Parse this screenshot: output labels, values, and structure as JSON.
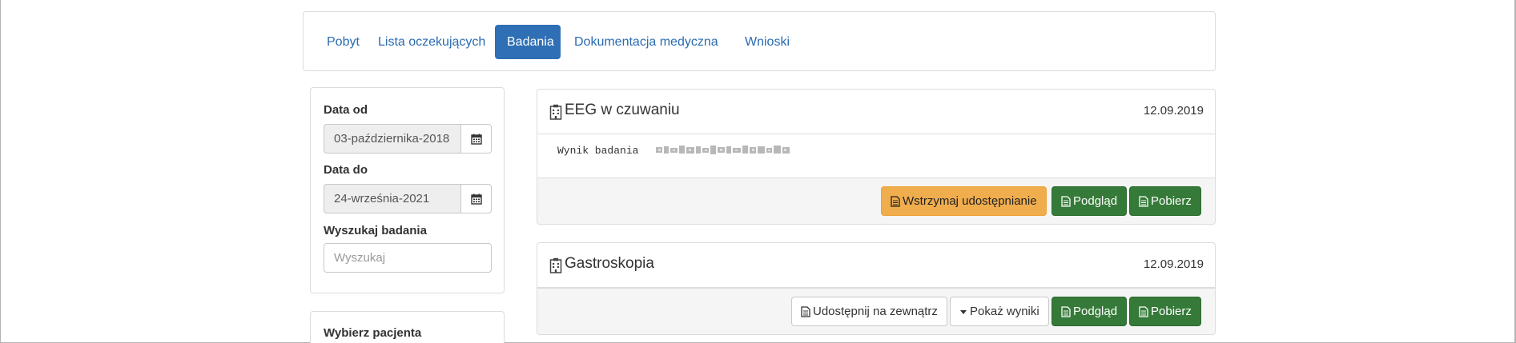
{
  "tabs": [
    {
      "label": "Pobyt",
      "active": false
    },
    {
      "label": "Lista oczekujących",
      "active": false
    },
    {
      "label": "Badania",
      "active": true
    },
    {
      "label": "Dokumentacja medyczna",
      "active": false
    },
    {
      "label": "Wnioski",
      "active": false
    }
  ],
  "filters": {
    "date_from_label": "Data od",
    "date_from_value": "03-października-2018",
    "date_to_label": "Data do",
    "date_to_value": "24-września-2021",
    "search_label": "Wyszukaj badania",
    "search_placeholder": "Wyszukaj",
    "calendar_icon": "calendar-icon"
  },
  "patient": {
    "label": "Wybierz pacjenta"
  },
  "exams": [
    {
      "title": "EEG w czuwaniu",
      "date": "12.09.2019",
      "result_text": "Wynik badania",
      "buttons": {
        "stop_share": "Wstrzymaj udostępnianie",
        "preview": "Podgląd",
        "download": "Pobierz"
      }
    },
    {
      "title": "Gastroskopia",
      "date": "12.09.2019",
      "buttons": {
        "share_external": "Udostępnij na zewnątrz",
        "show_results": "Pokaż wyniki",
        "preview": "Podgląd",
        "download": "Pobierz"
      }
    }
  ],
  "colors": {
    "primary": "#2f6fb5",
    "link": "#2a6bb1",
    "warning": "#f0ad4e",
    "success": "#357a38"
  }
}
